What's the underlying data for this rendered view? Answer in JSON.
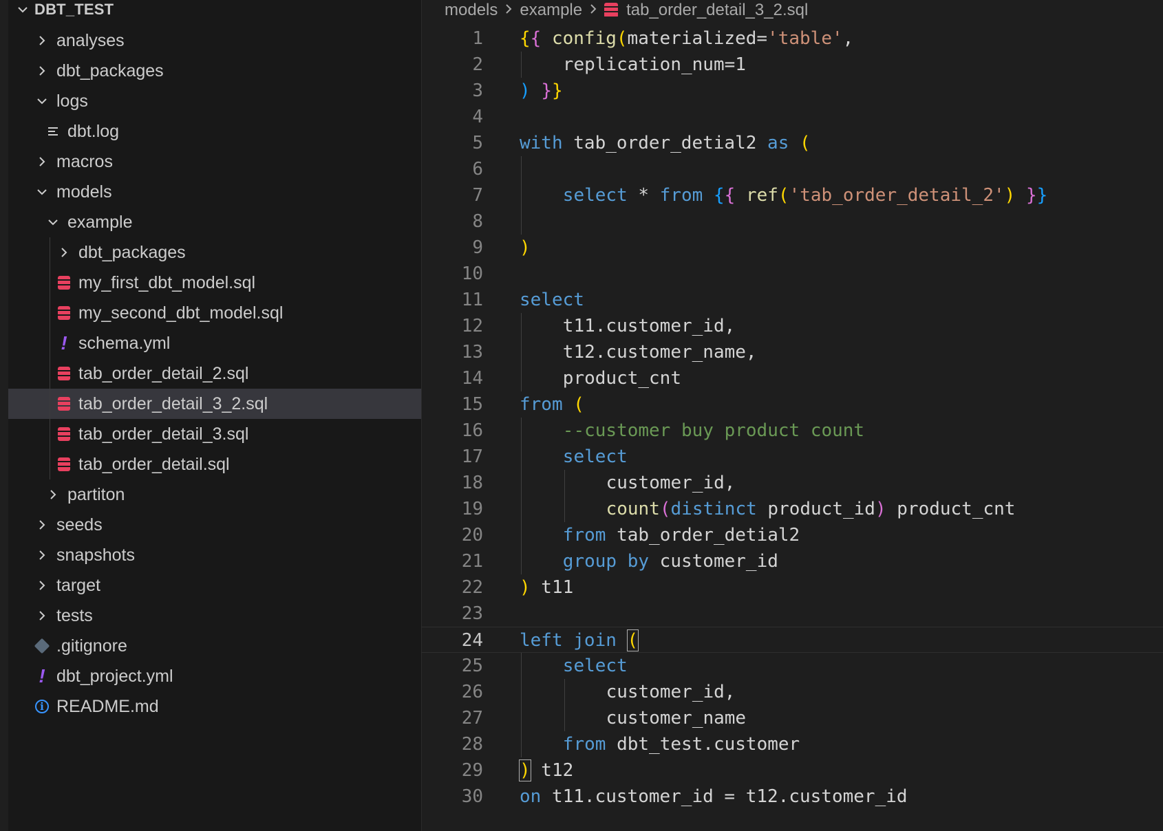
{
  "explorer": {
    "root_label": "DBT_TEST",
    "items": [
      {
        "label": "analyses",
        "kind": "folder",
        "expanded": false,
        "depth": 1
      },
      {
        "label": "dbt_packages",
        "kind": "folder",
        "expanded": false,
        "depth": 1
      },
      {
        "label": "logs",
        "kind": "folder",
        "expanded": true,
        "depth": 1
      },
      {
        "label": "dbt.log",
        "kind": "log-file",
        "depth": 2
      },
      {
        "label": "macros",
        "kind": "folder",
        "expanded": false,
        "depth": 1
      },
      {
        "label": "models",
        "kind": "folder",
        "expanded": true,
        "depth": 1
      },
      {
        "label": "example",
        "kind": "folder",
        "expanded": true,
        "depth": 2
      },
      {
        "label": "dbt_packages",
        "kind": "folder",
        "expanded": false,
        "depth": 3
      },
      {
        "label": "my_first_dbt_model.sql",
        "kind": "sql-file",
        "depth": 3
      },
      {
        "label": "my_second_dbt_model.sql",
        "kind": "sql-file",
        "depth": 3
      },
      {
        "label": "schema.yml",
        "kind": "yml-file",
        "depth": 3
      },
      {
        "label": "tab_order_detail_2.sql",
        "kind": "sql-file",
        "depth": 3
      },
      {
        "label": "tab_order_detail_3_2.sql",
        "kind": "sql-file",
        "depth": 3,
        "selected": true
      },
      {
        "label": "tab_order_detail_3.sql",
        "kind": "sql-file",
        "depth": 3
      },
      {
        "label": "tab_order_detail.sql",
        "kind": "sql-file",
        "depth": 3
      },
      {
        "label": "partiton",
        "kind": "folder",
        "expanded": false,
        "depth": 2
      },
      {
        "label": "seeds",
        "kind": "folder",
        "expanded": false,
        "depth": 1
      },
      {
        "label": "snapshots",
        "kind": "folder",
        "expanded": false,
        "depth": 1
      },
      {
        "label": "target",
        "kind": "folder",
        "expanded": false,
        "depth": 1
      },
      {
        "label": "tests",
        "kind": "folder",
        "expanded": false,
        "depth": 1
      },
      {
        "label": ".gitignore",
        "kind": "git-file",
        "depth": 1
      },
      {
        "label": "dbt_project.yml",
        "kind": "yml-file",
        "depth": 1
      },
      {
        "label": "README.md",
        "kind": "info-file",
        "depth": 1
      }
    ]
  },
  "breadcrumb": [
    "models",
    "example",
    "tab_order_detail_3_2.sql"
  ],
  "editor": {
    "current_line": 24,
    "lines": [
      {
        "n": "1",
        "indent": 0,
        "tokens": [
          [
            "b1",
            "{"
          ],
          [
            "b2",
            "{"
          ],
          [
            "pl",
            " "
          ],
          [
            "fn",
            "config"
          ],
          [
            "b1",
            "("
          ],
          [
            "pl",
            "materialized="
          ],
          [
            "str",
            "'table'"
          ],
          [
            "pl",
            ","
          ]
        ]
      },
      {
        "n": "2",
        "indent": 2,
        "tokens": [
          [
            "pl",
            "replication_num=1"
          ]
        ]
      },
      {
        "n": "3",
        "indent": 0,
        "tokens": [
          [
            "b3",
            ")"
          ],
          [
            "pl",
            " "
          ],
          [
            "b2",
            "}"
          ],
          [
            "b1",
            "}"
          ]
        ]
      },
      {
        "n": "4",
        "indent": 0,
        "tokens": []
      },
      {
        "n": "5",
        "indent": 0,
        "tokens": [
          [
            "kw",
            "with"
          ],
          [
            "pl",
            " tab_order_detial2 "
          ],
          [
            "kw",
            "as"
          ],
          [
            "pl",
            " "
          ],
          [
            "b1",
            "("
          ]
        ]
      },
      {
        "n": "6",
        "indent": 0,
        "tokens": []
      },
      {
        "n": "7",
        "indent": 2,
        "tokens": [
          [
            "kw",
            "select"
          ],
          [
            "pl",
            " * "
          ],
          [
            "kw",
            "from"
          ],
          [
            "pl",
            " "
          ],
          [
            "b3",
            "{"
          ],
          [
            "b2",
            "{"
          ],
          [
            "pl",
            " "
          ],
          [
            "fn",
            "ref"
          ],
          [
            "b1",
            "("
          ],
          [
            "str",
            "'tab_order_detail_2'"
          ],
          [
            "b1",
            ")"
          ],
          [
            "pl",
            " "
          ],
          [
            "b2",
            "}"
          ],
          [
            "b3",
            "}"
          ]
        ]
      },
      {
        "n": "8",
        "indent": 0,
        "tokens": []
      },
      {
        "n": "9",
        "indent": 0,
        "tokens": [
          [
            "b1",
            ")"
          ]
        ]
      },
      {
        "n": "10",
        "indent": 0,
        "tokens": []
      },
      {
        "n": "11",
        "indent": 0,
        "tokens": [
          [
            "kw",
            "select"
          ]
        ]
      },
      {
        "n": "12",
        "indent": 2,
        "tokens": [
          [
            "pl",
            "t11.customer_id,"
          ]
        ]
      },
      {
        "n": "13",
        "indent": 2,
        "tokens": [
          [
            "pl",
            "t12.customer_name,"
          ]
        ]
      },
      {
        "n": "14",
        "indent": 2,
        "tokens": [
          [
            "pl",
            "product_cnt"
          ]
        ]
      },
      {
        "n": "15",
        "indent": 0,
        "tokens": [
          [
            "kw",
            "from"
          ],
          [
            "pl",
            " "
          ],
          [
            "b1",
            "("
          ]
        ]
      },
      {
        "n": "16",
        "indent": 2,
        "tokens": [
          [
            "cm",
            "--customer buy product count"
          ]
        ]
      },
      {
        "n": "17",
        "indent": 2,
        "tokens": [
          [
            "kw",
            "select"
          ]
        ]
      },
      {
        "n": "18",
        "indent": 4,
        "tokens": [
          [
            "pl",
            "customer_id,"
          ]
        ]
      },
      {
        "n": "19",
        "indent": 4,
        "tokens": [
          [
            "fn",
            "count"
          ],
          [
            "b2",
            "("
          ],
          [
            "kw",
            "distinct"
          ],
          [
            "pl",
            " product_id"
          ],
          [
            "b2",
            ")"
          ],
          [
            "pl",
            " product_cnt"
          ]
        ]
      },
      {
        "n": "20",
        "indent": 2,
        "tokens": [
          [
            "kw",
            "from"
          ],
          [
            "pl",
            " tab_order_detial2"
          ]
        ]
      },
      {
        "n": "21",
        "indent": 2,
        "tokens": [
          [
            "kw",
            "group by"
          ],
          [
            "pl",
            " customer_id"
          ]
        ]
      },
      {
        "n": "22",
        "indent": 0,
        "tokens": [
          [
            "b1",
            ")"
          ],
          [
            "pl",
            " t11"
          ]
        ]
      },
      {
        "n": "23",
        "indent": 0,
        "tokens": []
      },
      {
        "n": "24",
        "indent": 0,
        "tokens": [
          [
            "kw",
            "left join"
          ],
          [
            "pl",
            " "
          ],
          [
            "b1m",
            "("
          ]
        ]
      },
      {
        "n": "25",
        "indent": 2,
        "tokens": [
          [
            "kw",
            "select"
          ]
        ]
      },
      {
        "n": "26",
        "indent": 4,
        "tokens": [
          [
            "pl",
            "customer_id,"
          ]
        ]
      },
      {
        "n": "27",
        "indent": 4,
        "tokens": [
          [
            "pl",
            "customer_name"
          ]
        ]
      },
      {
        "n": "28",
        "indent": 2,
        "tokens": [
          [
            "kw",
            "from"
          ],
          [
            "pl",
            " dbt_test.customer"
          ]
        ]
      },
      {
        "n": "29",
        "indent": 0,
        "tokens": [
          [
            "b1m",
            ")"
          ],
          [
            "pl",
            " t12"
          ]
        ]
      },
      {
        "n": "30",
        "indent": 0,
        "tokens": [
          [
            "kw",
            "on"
          ],
          [
            "pl",
            " t11.customer_id = t12.customer_id"
          ]
        ]
      }
    ]
  },
  "colors": {
    "keyword": "#569cd6",
    "string": "#ce9178",
    "function": "#dcdcaa",
    "comment": "#6a9955",
    "bracket_1": "#ffd700",
    "bracket_2": "#da70d6",
    "bracket_3": "#179fff",
    "sql_icon": "#e8405f"
  }
}
